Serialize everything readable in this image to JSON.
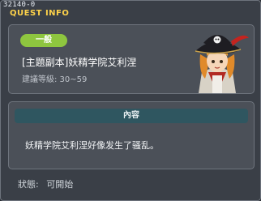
{
  "window": {
    "quest_id": "32140-0",
    "title": "QUEST INFO"
  },
  "quest": {
    "badge": "一般",
    "name": "[主題副本]妖精学院艾利涅",
    "recommended_level": "建議等級: 30~59",
    "portrait_icon": "pirate-captain-npc-icon"
  },
  "content": {
    "header": "內容",
    "description": "妖精学院艾利涅好像发生了骚乱。"
  },
  "status": {
    "label": "狀態:",
    "value": "可開始"
  },
  "colors": {
    "badge": "#8ec63f",
    "title": "#ffd34a",
    "content_header": "#2f5660"
  }
}
